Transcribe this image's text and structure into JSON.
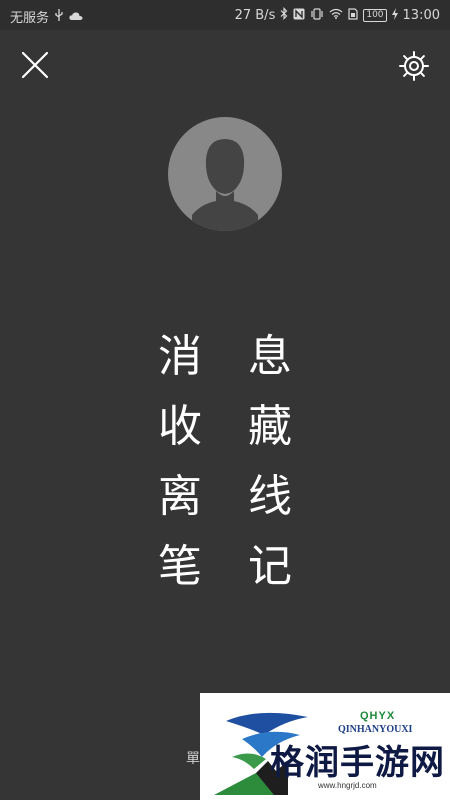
{
  "status_bar": {
    "carrier": "无服务",
    "speed": "27 B/s",
    "battery": "100",
    "time": "13:00",
    "icons": [
      "usb-icon",
      "cloud-icon",
      "bluetooth-icon",
      "nfc-icon",
      "vibrate-icon",
      "wifi-icon",
      "sim-icon",
      "battery-icon",
      "charging-icon"
    ]
  },
  "header": {
    "close_icon": "close-icon",
    "settings_icon": "gear-icon"
  },
  "avatar": {
    "icon": "default-avatar-icon"
  },
  "menu": {
    "items": [
      {
        "char1": "消",
        "char2": "息"
      },
      {
        "char1": "收",
        "char2": "藏"
      },
      {
        "char1": "离",
        "char2": "线"
      },
      {
        "char1": "笔",
        "char2": "记"
      }
    ]
  },
  "behind_text": "單",
  "watermark": {
    "code": "QHYX",
    "sub": "QINHANYOUXI",
    "name": "格润手游网",
    "url": "www.hngrjd.com"
  },
  "colors": {
    "background": "#353535",
    "status_bar": "#2e2e2e",
    "text": "#ffffff",
    "avatar_bg": "#888888"
  }
}
